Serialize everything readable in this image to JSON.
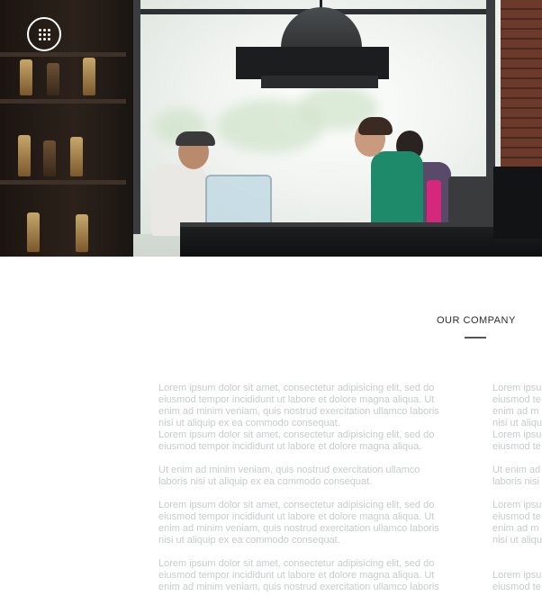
{
  "menu": {
    "icon": "grid-dots-icon"
  },
  "section": {
    "title": "OUR COMPANY"
  },
  "columns": [
    {
      "paragraphs": [
        "Lorem ipsum dolor sit amet, consectetur adipisicing elit, sed do\neiusmod tempor incididunt ut labore et dolore magna aliqua. Ut\nenim ad minim veniam, quis nostrud exercitation ullamco laboris\nnisi ut aliquip ex ea commodo consequat.\nLorem ipsum dolor sit amet, consectetur adipisicing elit, sed do\neiusmod tempor incididunt ut labore et dolore magna aliqua.",
        "Ut enim ad minim veniam, quis nostrud exercitation ullamco\nlaboris nisi ut aliquip ex ea commodo consequat.",
        "Lorem ipsum dolor sit amet, consectetur adipisicing elit, sed do\neiusmod tempor incididunt ut labore et dolore magna aliqua. Ut\nenim ad minim veniam, quis nostrud exercitation ullamco laboris\nnisi ut aliquip ex ea commodo consequat.",
        "Lorem ipsum dolor sit amet, consectetur adipisicing elit, sed do\neiusmod tempor incididunt ut labore et dolore magna aliqua. Ut\nenim ad minim veniam, quis nostrud exercitation ullamco laboris"
      ]
    },
    {
      "paragraphs": [
        "Lorem ipsu\neiusmod te\nenim ad m\nnisi ut aliqu\nLorem ipsu\neiusmod te",
        "Ut enim ad\nlaboris nisi",
        "Lorem ipsu\neiusmod te\nenim ad m\nnisi ut aliqu",
        "\nLorem ipsu\neiusmod te"
      ]
    }
  ]
}
